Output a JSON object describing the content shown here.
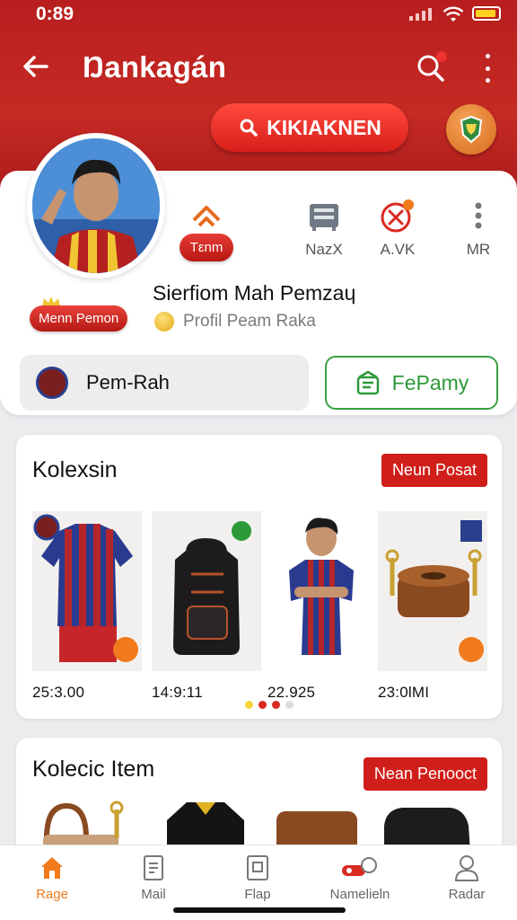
{
  "status": {
    "time": "0:89"
  },
  "header": {
    "title": "Ŋankagán",
    "cta_label": "KIKIAKNEN"
  },
  "profile": {
    "stats": [
      {
        "label": "Tεnm"
      },
      {
        "label": "NazX"
      },
      {
        "label": "A.VK"
      },
      {
        "label": "MR"
      }
    ],
    "rank_badge": "Menn Pemon",
    "name": "Sierfiom Mah Pemzaɥ",
    "subtitle": "Profil Peam Raka",
    "team_label": "Pem-Rah",
    "action_label": "FePamy"
  },
  "collection": {
    "title": "Kolexsin",
    "tag": "Neun Posat",
    "items": [
      {
        "price": "25:3.00"
      },
      {
        "price": "14:9:11"
      },
      {
        "price": "22.925"
      },
      {
        "price": "23:0lMI"
      }
    ]
  },
  "collection2": {
    "title": "Kolecic Item",
    "tag": "Nean Penooct"
  },
  "tabbar": {
    "items": [
      {
        "label": "Rage"
      },
      {
        "label": "Mail"
      },
      {
        "label": "Flap"
      },
      {
        "label": "Namelieln"
      },
      {
        "label": "Radar"
      }
    ]
  },
  "colors": {
    "brand_red": "#c52a24",
    "accent_green": "#2c9a38",
    "active_tab": "#f07a1c"
  }
}
